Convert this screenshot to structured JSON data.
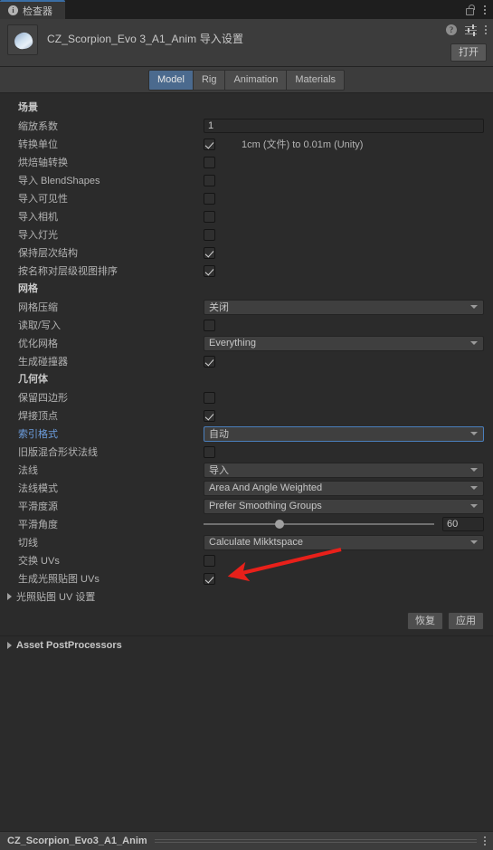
{
  "window": {
    "tab_label": "检查器",
    "info_icon": "info-icon",
    "lock_icon": "lock-open-icon",
    "menu_icon": "kebab-menu-icon"
  },
  "asset_header": {
    "title": "CZ_Scorpion_Evo 3_A1_Anim 导入设置",
    "thumbnail_icon": "mesh-preview-thumbnail",
    "help_icon": "help-icon",
    "preset_icon": "preset-settings-icon",
    "menu_icon": "kebab-menu-icon",
    "open_button": "打开"
  },
  "tabs": [
    {
      "label": "Model",
      "active": true
    },
    {
      "label": "Rig",
      "active": false
    },
    {
      "label": "Animation",
      "active": false
    },
    {
      "label": "Materials",
      "active": false
    }
  ],
  "sections": {
    "scene": {
      "title": "场景",
      "rows": [
        {
          "label": "缩放系数",
          "type": "text",
          "value": "1"
        },
        {
          "label": "转换单位",
          "type": "checkbox",
          "checked": true,
          "note": "1cm (文件) to 0.01m (Unity)"
        },
        {
          "label": "烘焙轴转换",
          "type": "checkbox",
          "checked": false
        },
        {
          "label": "导入 BlendShapes",
          "type": "checkbox",
          "checked": false
        },
        {
          "label": "导入可见性",
          "type": "checkbox",
          "checked": false
        },
        {
          "label": "导入相机",
          "type": "checkbox",
          "checked": false
        },
        {
          "label": "导入灯光",
          "type": "checkbox",
          "checked": false
        },
        {
          "label": "保持层次结构",
          "type": "checkbox",
          "checked": true
        },
        {
          "label": "按名称对层级视图排序",
          "type": "checkbox",
          "checked": true
        }
      ]
    },
    "meshes": {
      "title": "网格",
      "rows": [
        {
          "label": "网格压缩",
          "type": "dropdown",
          "value": "关闭"
        },
        {
          "label": "读取/写入",
          "type": "checkbox",
          "checked": false
        },
        {
          "label": "优化网格",
          "type": "dropdown",
          "value": "Everything"
        },
        {
          "label": "生成碰撞器",
          "type": "checkbox",
          "checked": true
        }
      ]
    },
    "geometry": {
      "title": "几何体",
      "rows": [
        {
          "label": "保留四边形",
          "type": "checkbox",
          "checked": false
        },
        {
          "label": "焊接顶点",
          "type": "checkbox",
          "checked": true
        },
        {
          "label": "索引格式",
          "type": "dropdown",
          "value": "自动",
          "focused": true
        },
        {
          "label": "旧版混合形状法线",
          "type": "checkbox",
          "checked": false
        },
        {
          "label": "法线",
          "type": "dropdown",
          "value": "导入"
        },
        {
          "label": "法线模式",
          "type": "dropdown",
          "value": "Area And Angle Weighted"
        },
        {
          "label": "平滑度源",
          "type": "dropdown",
          "value": "Prefer Smoothing Groups"
        },
        {
          "label": "平滑角度",
          "type": "slider",
          "value": "60",
          "percent": 33
        },
        {
          "label": "切线",
          "type": "dropdown",
          "value": "Calculate Mikktspace"
        },
        {
          "label": "交换 UVs",
          "type": "checkbox",
          "checked": false
        },
        {
          "label": "生成光照贴图 UVs",
          "type": "checkbox",
          "checked": true,
          "annotated": true
        }
      ],
      "foldout": "光照贴图 UV 设置"
    }
  },
  "buttons": {
    "revert": "恢复",
    "apply": "应用"
  },
  "post_processors": {
    "label": "Asset PostProcessors"
  },
  "footer": {
    "asset_name": "CZ_Scorpion_Evo3_A1_Anim",
    "menu_icon": "kebab-menu-icon"
  },
  "annotation": {
    "arrow_color": "#e8201a",
    "icon": "pointer-arrow-annotation"
  },
  "colors": {
    "accent_tab": "#4b6a8e",
    "focus_blue": "#6d9fe0",
    "background": "#2b2b2b",
    "panel": "#3c3c3c"
  }
}
